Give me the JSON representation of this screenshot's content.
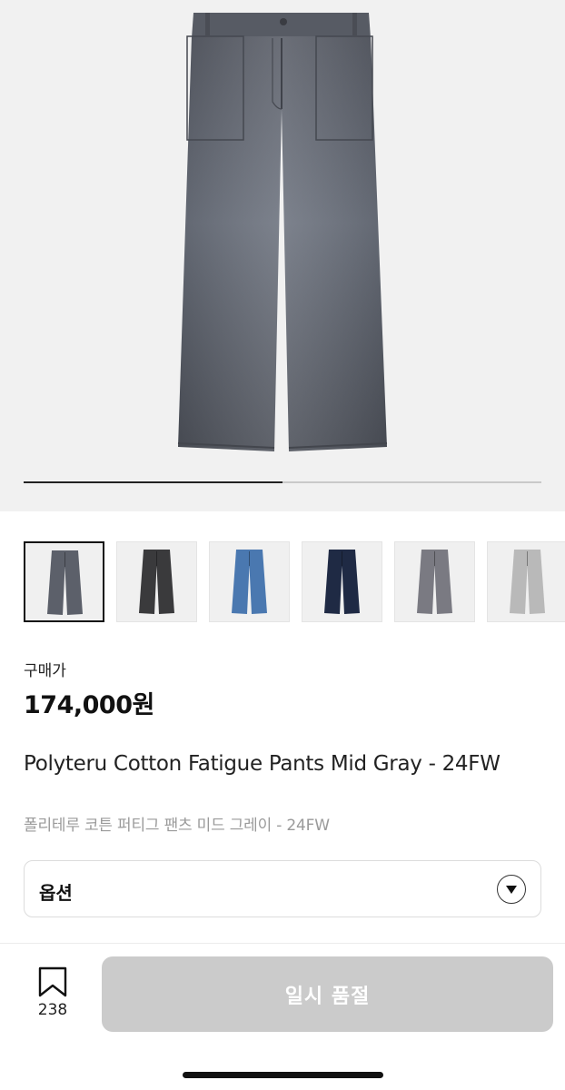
{
  "product": {
    "image_progress": 0.5,
    "thumbnails": [
      {
        "name": "mid-gray",
        "color": "#5c606a",
        "selected": true
      },
      {
        "name": "black",
        "color": "#3a3a3c",
        "selected": false
      },
      {
        "name": "blue",
        "color": "#4a78b0",
        "selected": false
      },
      {
        "name": "navy",
        "color": "#1f2a44",
        "selected": false
      },
      {
        "name": "gray",
        "color": "#7a7a82",
        "selected": false
      },
      {
        "name": "light-gray",
        "color": "#b9b9b9",
        "selected": false
      }
    ],
    "price_label": "구매가",
    "price": "174,000원",
    "title_en": "Polyteru Cotton Fatigue Pants Mid Gray - 24FW",
    "title_ko": "폴리테루 코튼 퍼티그 팬츠 미드 그레이 - 24FW"
  },
  "option": {
    "label": "옵션",
    "icon": "chevron-down-icon"
  },
  "bottom_bar": {
    "bookmark_icon": "bookmark-icon",
    "bookmark_count": "238",
    "purchase_label": "일시 품절"
  },
  "colors": {
    "hero_bg": "#f1f1f1",
    "pants_main": "#5c606a",
    "disabled_button": "#cbcbcb"
  }
}
